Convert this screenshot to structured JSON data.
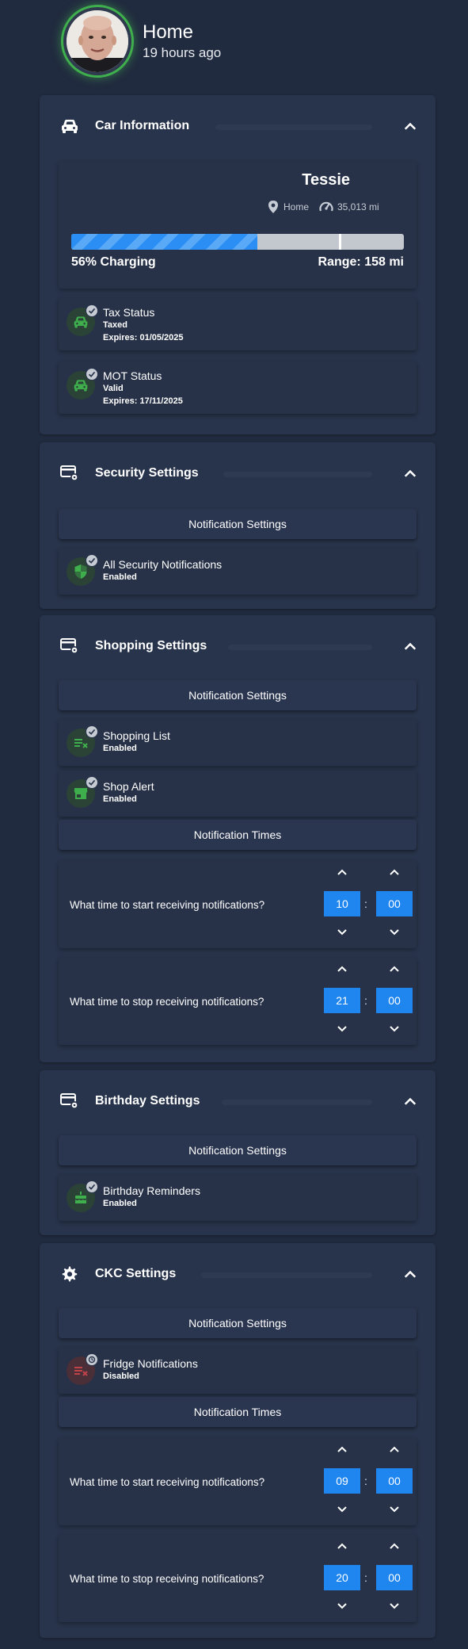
{
  "header": {
    "title": "Home",
    "subtitle": "19 hours ago"
  },
  "car": {
    "title": "Car Information",
    "icon": "car-icon",
    "name": "Tessie",
    "location": "Home",
    "odometer": "35,013 mi",
    "charge_percent": 56,
    "charge_label": "56% Charging",
    "range_label": "Range: 158 mi",
    "tax": {
      "title": "Tax Status",
      "l1": "Taxed",
      "l2": "Expires: 01/05/2025"
    },
    "mot": {
      "title": "MOT Status",
      "l1": "Valid",
      "l2": "Expires: 17/11/2025"
    }
  },
  "security": {
    "title": "Security Settings",
    "icon": "settings-card-icon",
    "notif_btn": "Notification Settings",
    "item": {
      "title": "All Security Notifications",
      "status": "Enabled"
    }
  },
  "shopping": {
    "title": "Shopping Settings",
    "icon": "settings-card-icon",
    "notif_btn": "Notification Settings",
    "items": [
      {
        "title": "Shopping List",
        "status": "Enabled"
      },
      {
        "title": "Shop Alert",
        "status": "Enabled"
      }
    ],
    "times_btn": "Notification Times",
    "start": {
      "question": "What time to start receiving notifications?",
      "hour": "10",
      "minute": "00"
    },
    "stop": {
      "question": "What time to stop receiving notifications?",
      "hour": "21",
      "minute": "00"
    }
  },
  "birthday": {
    "title": "Birthday Settings",
    "icon": "settings-card-icon",
    "notif_btn": "Notification Settings",
    "item": {
      "title": "Birthday Reminders",
      "status": "Enabled"
    }
  },
  "ckc": {
    "title": "CKC Settings",
    "icon": "gear-icon",
    "notif_btn": "Notification Settings",
    "item": {
      "title": "Fridge Notifications",
      "status": "Disabled"
    },
    "times_btn": "Notification Times",
    "start": {
      "question": "What time to start receiving notifications?",
      "hour": "09",
      "minute": "00"
    },
    "stop": {
      "question": "What time to stop receiving notifications?",
      "hour": "20",
      "minute": "00"
    }
  },
  "colors": {
    "background": "#212b3f",
    "card": "#28344b",
    "accent_blue": "#1f86ef",
    "enabled_green": "#3fae4d",
    "disabled_red": "#c0434a"
  }
}
